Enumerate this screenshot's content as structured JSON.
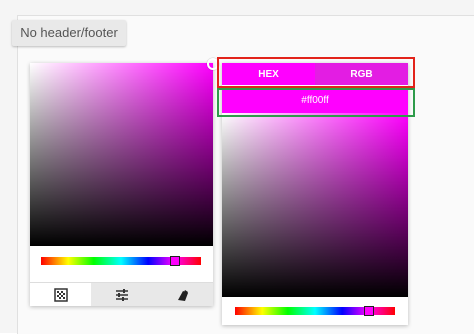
{
  "chip": {
    "label": "No header/footer"
  },
  "left_picker": {
    "hue_level_percent": 83,
    "tabs": [
      {
        "name": "palette-icon"
      },
      {
        "name": "sliders-icon"
      },
      {
        "name": "eyedropper-icon"
      }
    ]
  },
  "right_picker": {
    "tabs": [
      "HEX",
      "RGB"
    ],
    "selected_tab": "HEX",
    "hex_value": "#ff00ff",
    "hue_level_percent": 83
  },
  "colors": {
    "accent": "#ff00ff",
    "annotation_red": "#e2231a",
    "annotation_green": "#2e9b4a"
  }
}
